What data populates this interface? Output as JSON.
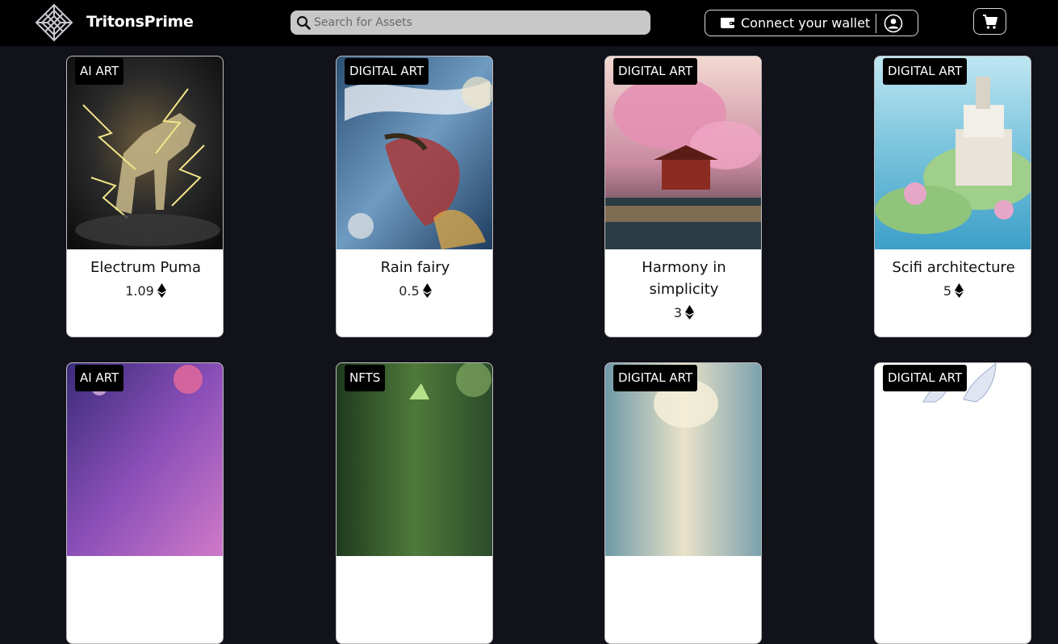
{
  "brand": {
    "name": "TritonsPrime"
  },
  "search": {
    "placeholder": "Search for Assets",
    "value": ""
  },
  "wallet": {
    "label": "Connect your wallet"
  },
  "colors": {
    "page_bg": "#12121b",
    "navbar_bg": "#000000",
    "search_bg": "#c8c8c8",
    "card_bg": "#ffffff",
    "badge_bg": "#000000"
  },
  "icons": {
    "search": "search-icon",
    "wallet": "wallet-icon",
    "user": "user-icon",
    "cart": "cart-icon",
    "currency": "ethereum-icon"
  },
  "assets": [
    {
      "category": "AI ART",
      "title": "Electrum Puma",
      "price": "1.09"
    },
    {
      "category": "DIGITAL ART",
      "title": "Rain fairy",
      "price": "0.5"
    },
    {
      "category": "DIGITAL ART",
      "title": "Harmony in simplicity",
      "price": "3"
    },
    {
      "category": "DIGITAL ART",
      "title": "Scifi architecture",
      "price": "5"
    },
    {
      "category": "AI ART"
    },
    {
      "category": "NFTS"
    },
    {
      "category": "DIGITAL ART"
    },
    {
      "category": "DIGITAL ART"
    }
  ]
}
